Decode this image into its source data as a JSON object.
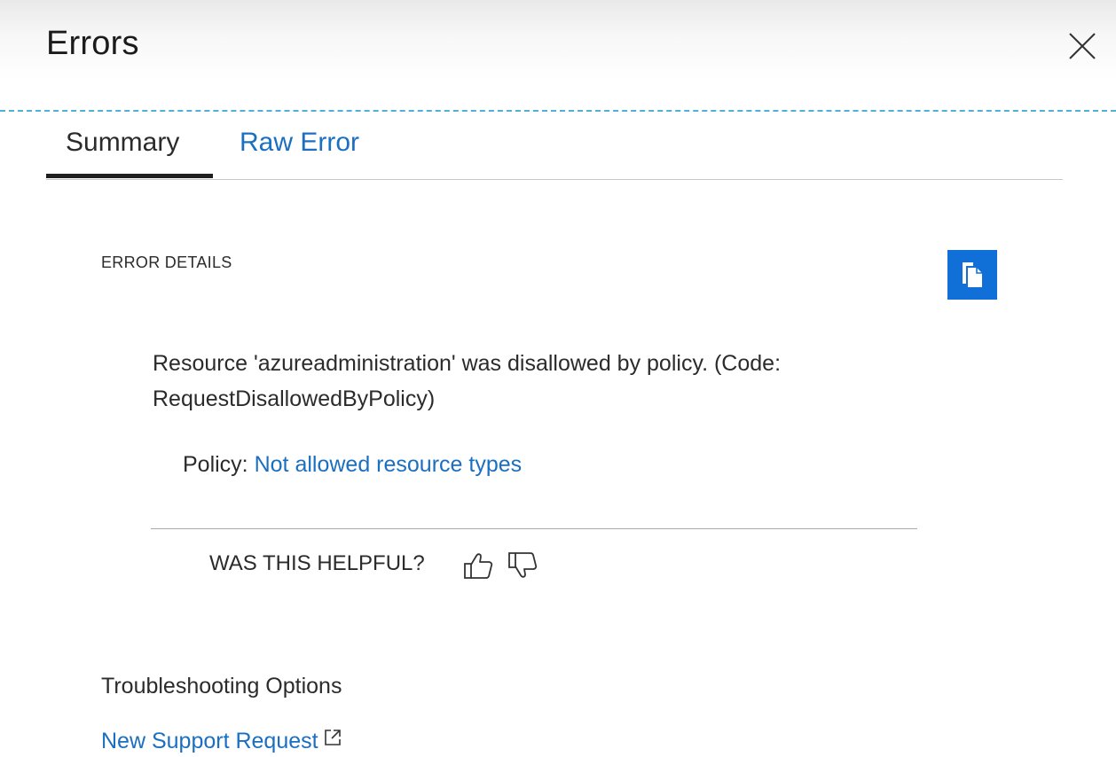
{
  "panel": {
    "title": "Errors",
    "close_icon": "close-icon"
  },
  "tabs": [
    {
      "label": "Summary",
      "active": true
    },
    {
      "label": "Raw Error",
      "active": false
    }
  ],
  "error_details": {
    "section_label": "ERROR DETAILS",
    "copy_icon": "copy-icon",
    "message_line1": "Resource 'azureadministration' was disallowed by policy. (Code:",
    "message_line2": "RequestDisallowedByPolicy)",
    "policy_label": "Policy: ",
    "policy_link": "Not allowed resource types"
  },
  "feedback": {
    "question": "WAS THIS HELPFUL?",
    "thumbs_up_icon": "thumbs-up-icon",
    "thumbs_down_icon": "thumbs-down-icon"
  },
  "troubleshooting": {
    "heading": "Troubleshooting Options",
    "support_link": "New Support Request",
    "external_icon": "external-link-icon"
  },
  "colors": {
    "link": "#1a6fc0",
    "accent_button": "#1070d8",
    "dashed_border": "#4fb0d8",
    "text": "#2b2b2b"
  }
}
